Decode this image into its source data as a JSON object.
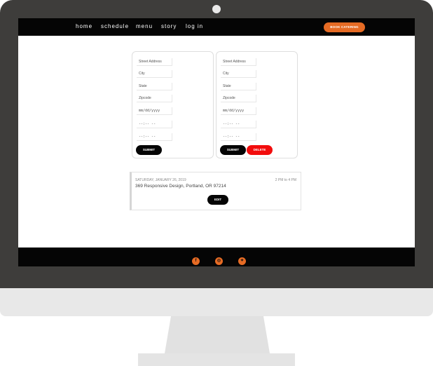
{
  "nav": {
    "links": [
      "home",
      "schedule",
      "menu",
      "story",
      "log in"
    ],
    "cta_label": "BOOK CATERING"
  },
  "form_left": {
    "fields": [
      "Street Address",
      "City",
      "State",
      "Zipcode",
      "mm/dd/yyyy",
      "--:-- --",
      "--:-- --"
    ],
    "submit_label": "SUBMIT"
  },
  "form_right": {
    "fields": [
      "Street Address",
      "City",
      "State",
      "Zipcode",
      "mm/dd/yyyy",
      "--:-- --",
      "--:-- --"
    ],
    "submit_label": "SUBMIT",
    "delete_label": "DELETE"
  },
  "event": {
    "date": "SATURDAY, JANUARY 26, 2019",
    "time": "2 PM to 4 PM",
    "address": "369 Responsive Design, Portland, OR 97214",
    "edit_label": "EDIT"
  },
  "footer": {
    "icons": [
      "facebook-icon",
      "instagram-icon",
      "twitter-icon"
    ]
  },
  "colors": {
    "accent": "#e66b24",
    "danger": "#f20d0d",
    "nav_bg": "#050505",
    "frame": "#3e3d3b"
  }
}
